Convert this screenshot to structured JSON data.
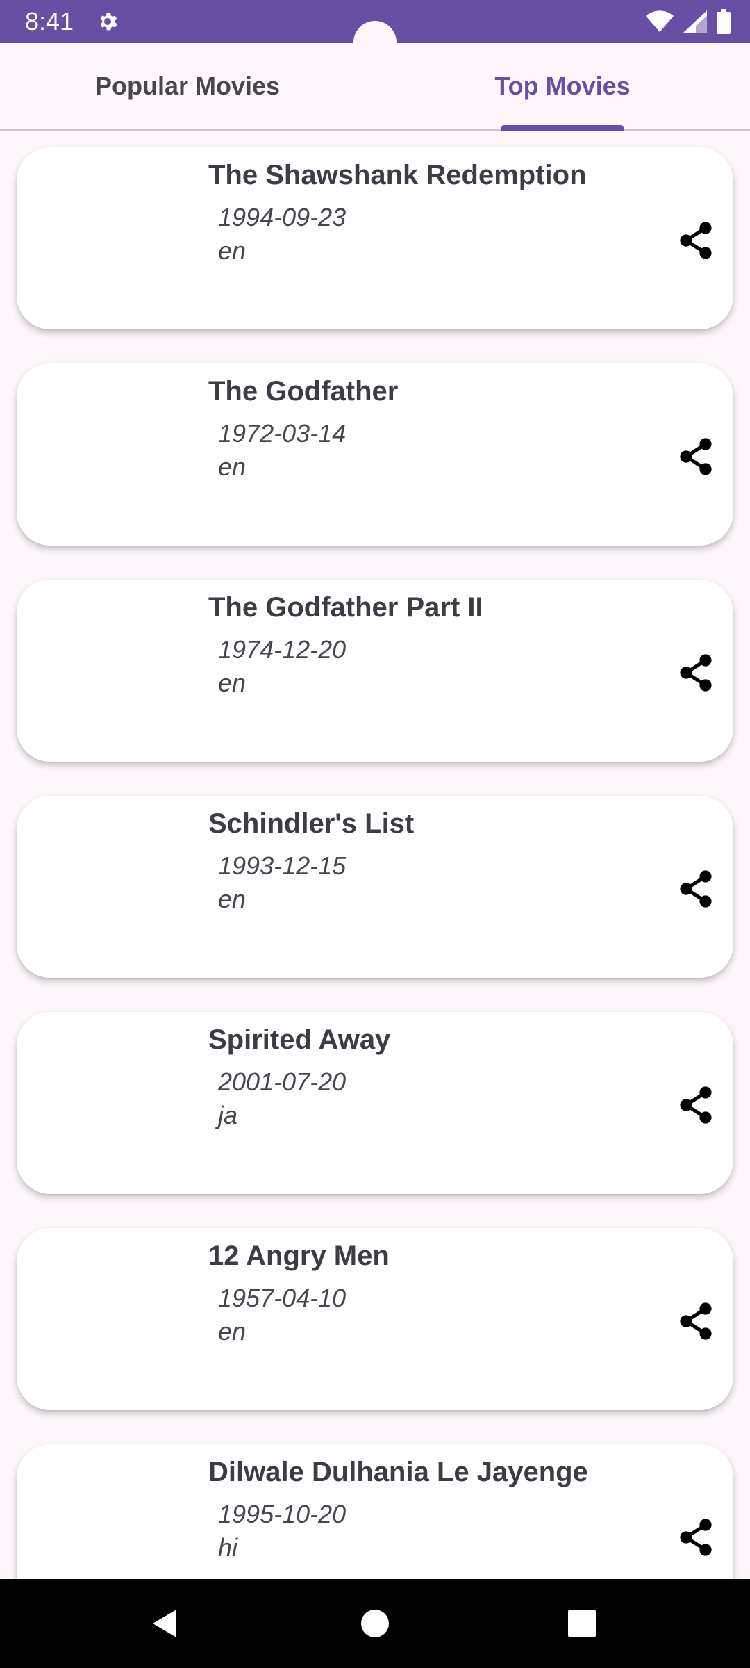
{
  "status": {
    "time": "8:41"
  },
  "tabs": [
    {
      "label": "Popular Movies",
      "selected": false
    },
    {
      "label": "Top Movies",
      "selected": true
    }
  ],
  "movies": [
    {
      "title": "The Shawshank Redemption",
      "date": "1994-09-23",
      "lang": "en"
    },
    {
      "title": "The Godfather",
      "date": "1972-03-14",
      "lang": "en"
    },
    {
      "title": "The Godfather Part II",
      "date": "1974-12-20",
      "lang": "en"
    },
    {
      "title": "Schindler's List",
      "date": "1993-12-15",
      "lang": "en"
    },
    {
      "title": "Spirited Away",
      "date": "2001-07-20",
      "lang": "ja"
    },
    {
      "title": "12 Angry Men",
      "date": "1957-04-10",
      "lang": "en"
    },
    {
      "title": "Dilwale Dulhania Le Jayenge",
      "date": "1995-10-20",
      "lang": "hi"
    }
  ],
  "colors": {
    "accent": "#6750a4",
    "background": "#fdf7fc"
  },
  "icons": {
    "status": [
      "gear-icon",
      "wifi-icon",
      "signal-icon",
      "battery-icon"
    ],
    "card": "share-icon",
    "nav": [
      "back-icon",
      "home-icon",
      "recents-icon"
    ]
  }
}
